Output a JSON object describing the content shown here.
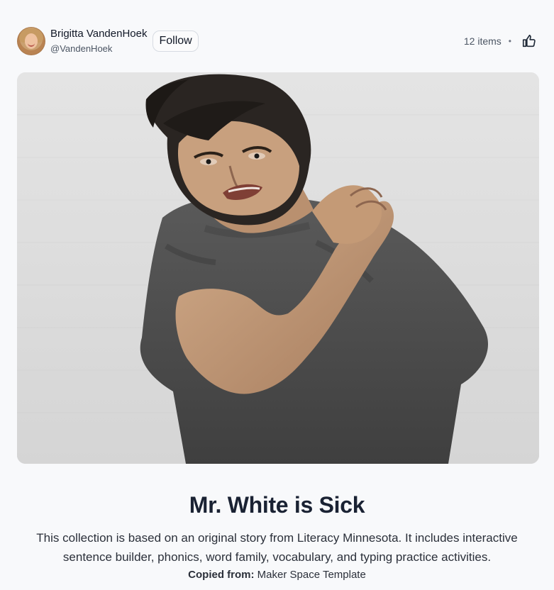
{
  "author": {
    "name": "Brigitta VandenHoek",
    "handle": "@VandenHoek",
    "follow_label": "Follow"
  },
  "meta": {
    "items_count": "12 items",
    "separator": "•",
    "like_icon": "thumbs-up-icon"
  },
  "hero": {
    "image_alt": "",
    "icon": "hero-photo"
  },
  "collection": {
    "title": "Mr. White is Sick",
    "description": "This collection is based on an original story from Literacy Minnesota. It includes interactive sentence builder, phonics, word family, vocabulary, and typing practice activities.",
    "copied_from_label": "Copied from:",
    "copied_from_value": "Maker Space Template"
  }
}
